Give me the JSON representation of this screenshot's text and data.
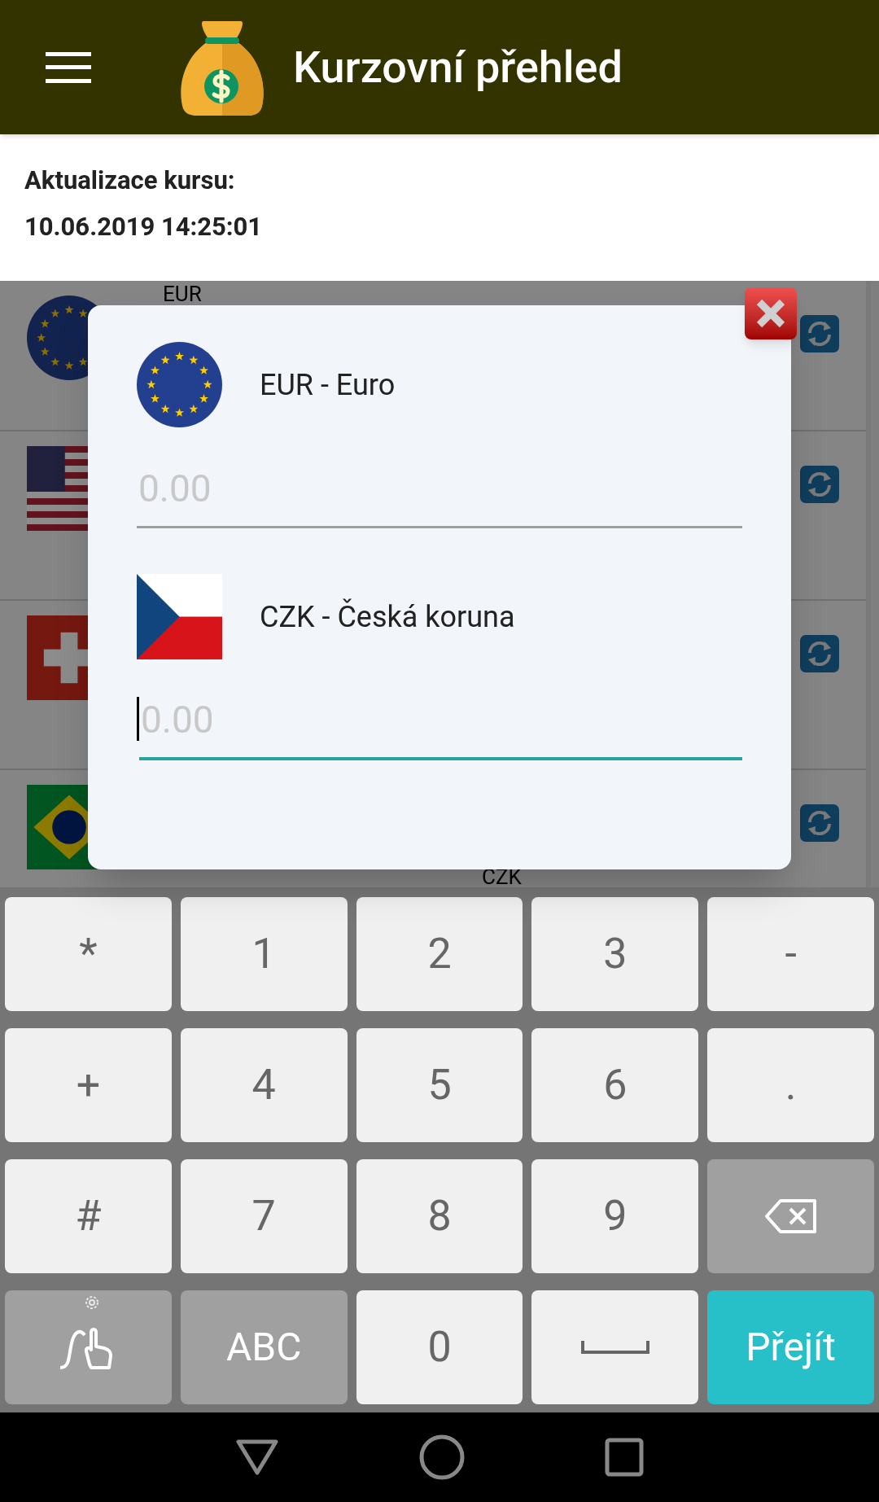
{
  "app_bar": {
    "title": "Kurzovní přehled"
  },
  "update_info": {
    "label": "Aktualizace kursu:",
    "timestamp": "10.06.2019 14:25:01"
  },
  "currency_list": [
    {
      "kind": "eu",
      "code": "EUR"
    },
    {
      "kind": "us"
    },
    {
      "kind": "ch"
    },
    {
      "kind": "br",
      "rate_unit": "CZK"
    }
  ],
  "converter_dialog": {
    "fields": [
      {
        "kind": "eu",
        "currency": "EUR - Euro",
        "placeholder": "0.00",
        "focused": false
      },
      {
        "kind": "cz",
        "currency": "CZK - Česká koruna",
        "placeholder": "0.00",
        "focused": true
      }
    ]
  },
  "keyboard": {
    "rows": [
      [
        {
          "kind": "char",
          "label": "*"
        },
        {
          "kind": "char",
          "label": "1"
        },
        {
          "kind": "char",
          "label": "2"
        },
        {
          "kind": "char",
          "label": "3"
        },
        {
          "kind": "char",
          "label": "-"
        }
      ],
      [
        {
          "kind": "char",
          "label": "+"
        },
        {
          "kind": "char",
          "label": "4"
        },
        {
          "kind": "char",
          "label": "5"
        },
        {
          "kind": "char",
          "label": "6"
        },
        {
          "kind": "char",
          "label": "."
        }
      ],
      [
        {
          "kind": "char",
          "label": "#"
        },
        {
          "kind": "char",
          "label": "7"
        },
        {
          "kind": "char",
          "label": "8"
        },
        {
          "kind": "char",
          "label": "9"
        },
        {
          "kind": "backspace"
        }
      ],
      [
        {
          "kind": "gesture"
        },
        {
          "kind": "mode",
          "label": "ABC"
        },
        {
          "kind": "char",
          "label": "0"
        },
        {
          "kind": "space"
        },
        {
          "kind": "go",
          "label": "Přejít"
        }
      ]
    ]
  }
}
